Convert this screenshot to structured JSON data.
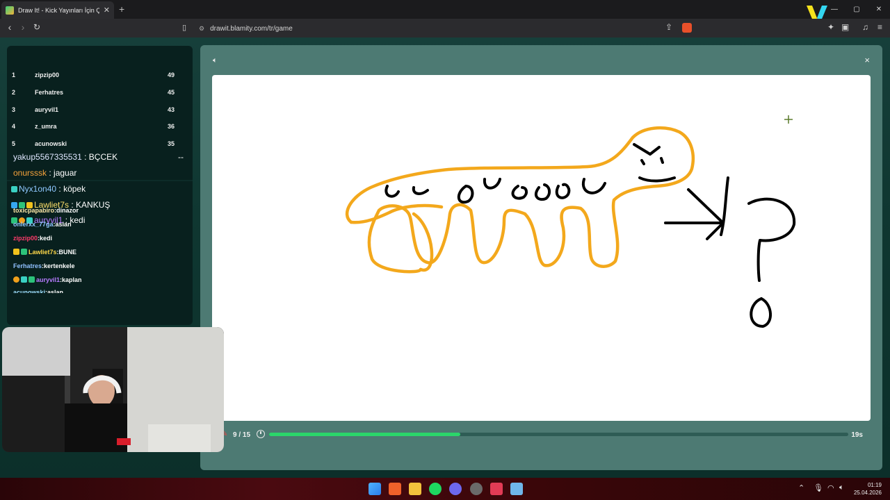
{
  "browser": {
    "tab_title": "Draw It! - Kick Yayınları İçin Çizim",
    "tab_close": "✕",
    "new_tab": "+",
    "url": "drawit.blamity.com/tr/game",
    "window_controls": [
      "—",
      "▢",
      "✕"
    ]
  },
  "leaderboard": [
    {
      "rank": "1",
      "name": "zipzip00",
      "score": "49"
    },
    {
      "rank": "2",
      "name": "Ferhatres",
      "score": "45"
    },
    {
      "rank": "3",
      "name": "auryvil1",
      "score": "43"
    },
    {
      "rank": "4",
      "name": "z_umra",
      "score": "36"
    },
    {
      "rank": "5",
      "name": "acunowski",
      "score": "35"
    }
  ],
  "chat_large": [
    {
      "user": "yakup5567335531",
      "user_color": "#dfe6ff",
      "sep": " : ",
      "text": "BÇCEK",
      "extra": "--"
    },
    {
      "user": "onursssk",
      "user_color": "#f6a33b",
      "sep": " : ",
      "text": "jaguar"
    },
    {
      "user": "Nyx1on40",
      "user_color": "#8fc8ff",
      "sep": " : ",
      "text": "köpek"
    },
    {
      "user": "Lawliet7s",
      "user_color": "#ffe16a",
      "sep": " : ",
      "text": "KANKUŞ"
    },
    {
      "user": "auryvil1",
      "user_color": "#b77cff",
      "sep": " : ",
      "text": "kedi"
    }
  ],
  "chat_small": [
    {
      "user": "toxicpapabiro",
      "user_color": "#ffe9a8",
      "sep": ":",
      "text": "dinazor"
    },
    {
      "user": "onlerxx_77ga",
      "user_color": "#8fc8ff",
      "sep": ":",
      "text": "aslan"
    },
    {
      "user": "zipzip00",
      "user_color": "#ff3b6b",
      "sep": ":",
      "text": "kedi"
    },
    {
      "user": "Lawliet7s",
      "user_color": "#ffd84a",
      "sep": ":",
      "text": "BUNE"
    },
    {
      "user": "Ferhatres",
      "user_color": "#8fc0ff",
      "sep": ":",
      "text": "kertenkele"
    },
    {
      "user": "auryvil1",
      "user_color": "#b77cff",
      "sep": ":",
      "text": "kaplan"
    },
    {
      "user": "acunowski",
      "user_color": "#9fe0ff",
      "sep": ":",
      "text": "aslan"
    }
  ],
  "game": {
    "round": "9 / 15",
    "progress_fraction": 0.33,
    "seconds_left": "19s",
    "close": "×"
  },
  "taskbar": {
    "time": "01:19",
    "date": "25.04.2026"
  },
  "colors": {
    "drawing_orange": "#f3a81c",
    "drawing_black": "#000000",
    "progress_green": "#2bd66a"
  }
}
